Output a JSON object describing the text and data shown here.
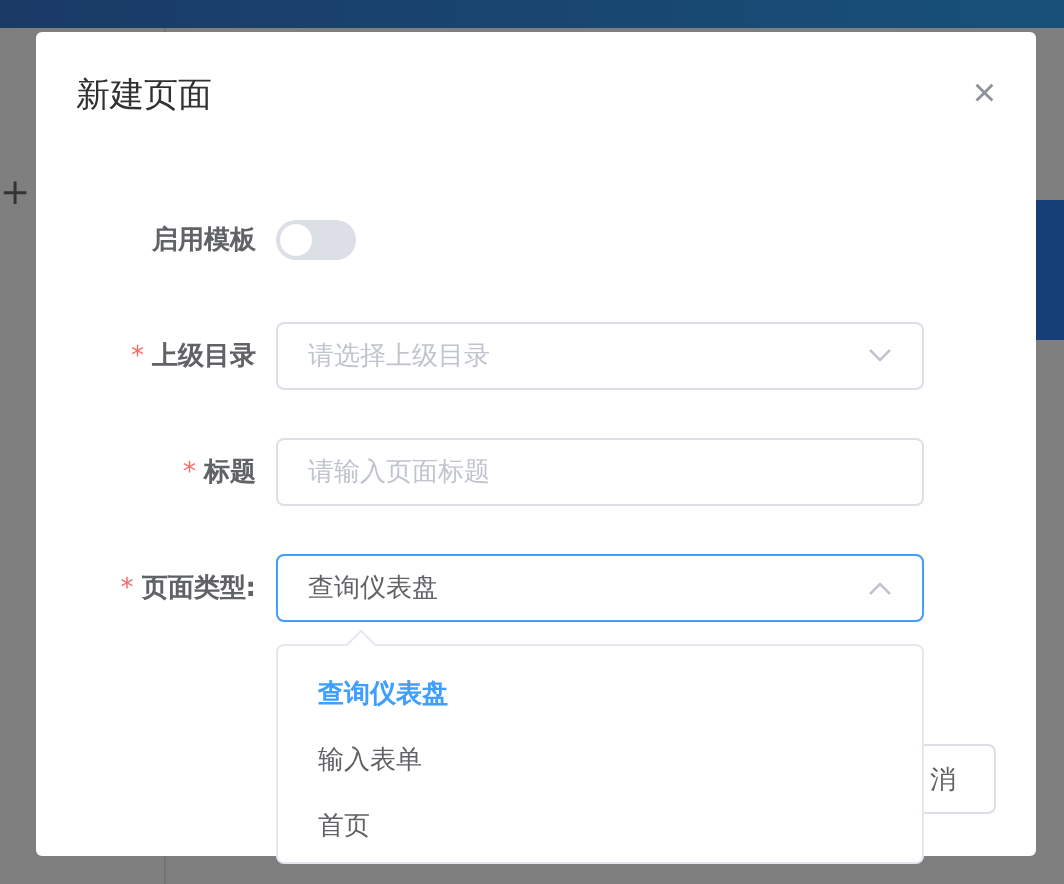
{
  "background": {
    "add_symbol": "+"
  },
  "dialog": {
    "title": "新建页面",
    "close": "×",
    "required_mark": "*",
    "fields": [
      {
        "kind": "switch",
        "label": "启用模板",
        "required": false,
        "on": false
      },
      {
        "kind": "select",
        "label": "上级目录",
        "required": true,
        "placeholder": "请选择上级目录",
        "expanded": false
      },
      {
        "kind": "input",
        "label": "标题",
        "required": true,
        "placeholder": "请输入页面标题"
      },
      {
        "kind": "select",
        "label": "页面类型:",
        "required": true,
        "value": "查询仪表盘",
        "expanded": true
      }
    ],
    "dropdown": [
      {
        "label": "查询仪表盘",
        "selected": true
      },
      {
        "label": "输入表单",
        "selected": false
      },
      {
        "label": "首页",
        "selected": false
      }
    ],
    "buttons": [
      "消"
    ]
  }
}
